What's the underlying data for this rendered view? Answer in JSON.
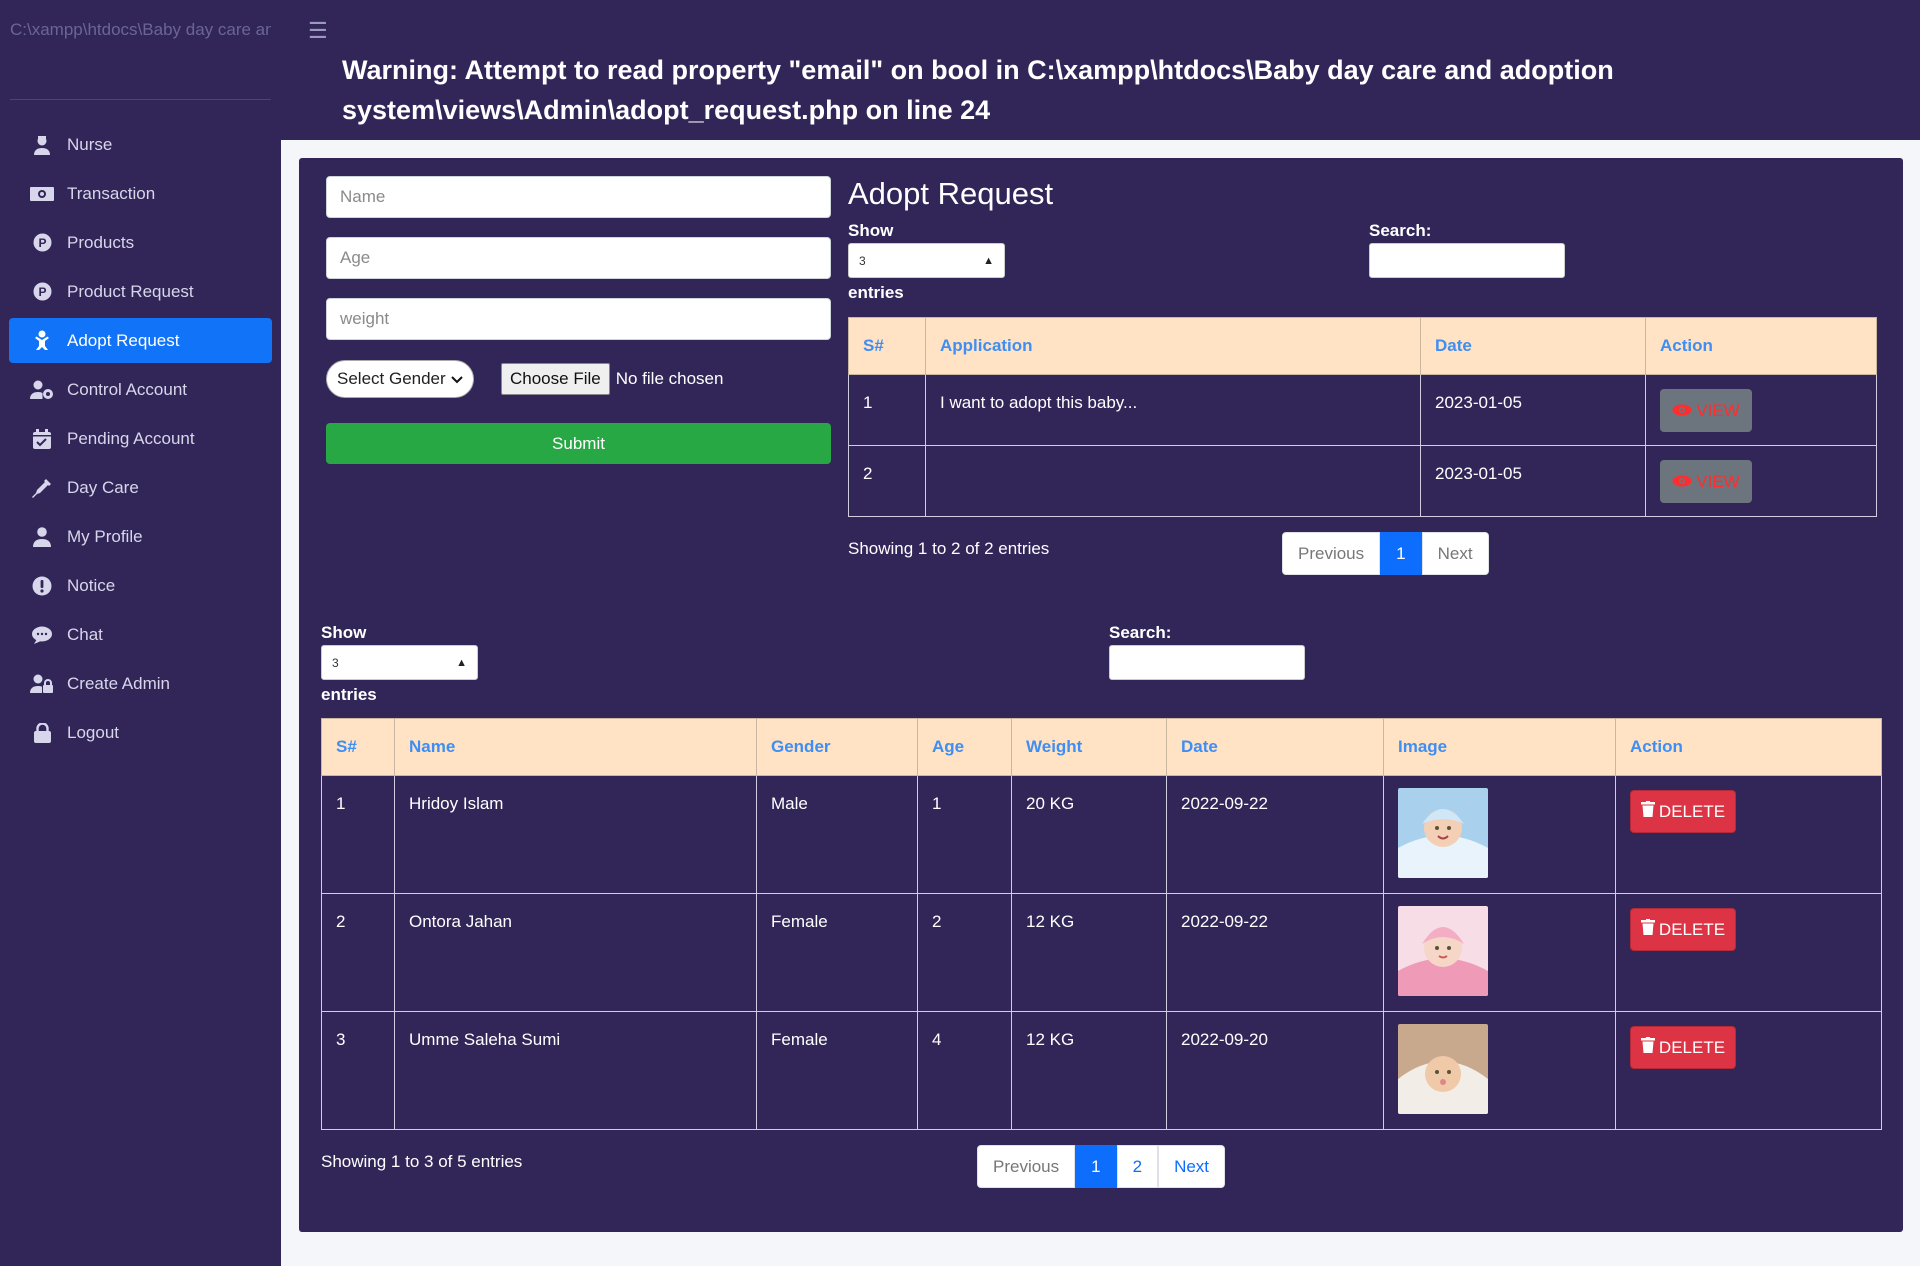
{
  "sidebar": {
    "brand": "C:\\xampp\\htdocs\\Baby day care an",
    "items": [
      {
        "label": "Nurse",
        "icon": "nurse-icon"
      },
      {
        "label": "Transaction",
        "icon": "money-icon"
      },
      {
        "label": "Products",
        "icon": "product-icon"
      },
      {
        "label": "Product Request",
        "icon": "product-icon"
      },
      {
        "label": "Adopt Request",
        "icon": "baby-icon",
        "active": true
      },
      {
        "label": "Control Account",
        "icon": "user-cog-icon"
      },
      {
        "label": "Pending Account",
        "icon": "calendar-check-icon"
      },
      {
        "label": "Day Care",
        "icon": "syringe-icon"
      },
      {
        "label": "My Profile",
        "icon": "user-icon"
      },
      {
        "label": "Notice",
        "icon": "exclamation-icon"
      },
      {
        "label": "Chat",
        "icon": "sms-icon"
      },
      {
        "label": "Create Admin",
        "icon": "user-lock-icon"
      },
      {
        "label": "Logout",
        "icon": "lock-icon"
      }
    ]
  },
  "header": {
    "warning": "Warning: Attempt to read property \"email\" on bool in C:\\xampp\\htdocs\\Baby day care and adoption system\\views\\Admin\\adopt_request.php on line 24"
  },
  "form": {
    "name_placeholder": "Name",
    "age_placeholder": "Age",
    "weight_placeholder": "weight",
    "gender_select": "Select Gender",
    "choose_file": "Choose File",
    "no_file": "No file chosen",
    "submit": "Submit"
  },
  "adopt_request": {
    "title": "Adopt Request",
    "show": "Show",
    "entries": "entries",
    "search": "Search:",
    "length_value": "3",
    "columns": [
      "S#",
      "Application",
      "Date",
      "Action"
    ],
    "rows": [
      {
        "sn": "1",
        "application": "I want to adopt this baby...",
        "date": "2023-01-05",
        "action": "VIEW"
      },
      {
        "sn": "2",
        "application": "",
        "date": "2023-01-05",
        "action": "VIEW"
      }
    ],
    "info": "Showing 1 to 2 of 2 entries",
    "pager": {
      "prev": "Previous",
      "page": "1",
      "next": "Next"
    }
  },
  "babies": {
    "show": "Show",
    "entries": "entries",
    "search": "Search:",
    "length_value": "3",
    "columns": [
      "S#",
      "Name",
      "Gender",
      "Age",
      "Weight",
      "Date",
      "Image",
      "Action"
    ],
    "rows": [
      {
        "sn": "1",
        "name": "Hridoy Islam",
        "gender": "Male",
        "age": "1",
        "weight": "20 KG",
        "date": "2022-09-22",
        "action": "DELETE"
      },
      {
        "sn": "2",
        "name": "Ontora Jahan",
        "gender": "Female",
        "age": "2",
        "weight": "12 KG",
        "date": "2022-09-22",
        "action": "DELETE"
      },
      {
        "sn": "3",
        "name": "Umme Saleha Sumi",
        "gender": "Female",
        "age": "4",
        "weight": "12 KG",
        "date": "2022-09-20",
        "action": "DELETE"
      }
    ],
    "info": "Showing 1 to 3 of 5 entries",
    "pager": {
      "prev": "Previous",
      "page1": "1",
      "page2": "2",
      "next": "Next"
    }
  },
  "colors": {
    "sidebar_bg": "#322659",
    "active": "#1173f8",
    "header_th": "#ffe3c4",
    "submit": "#27a844",
    "delete": "#dc3444",
    "view": "#6c757d"
  }
}
